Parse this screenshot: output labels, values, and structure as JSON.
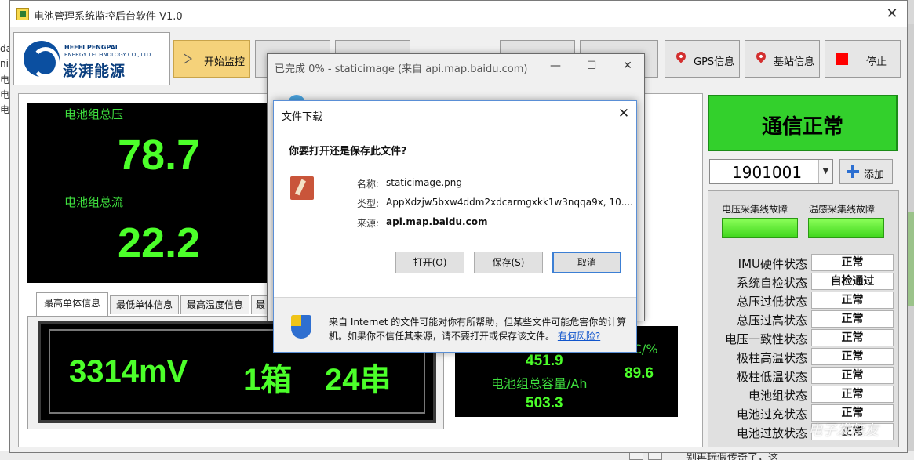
{
  "background": {
    "left_strip_texts": [
      "da",
      "niv",
      "电",
      "电",
      "电"
    ],
    "bottom_text": "别再玩假传奇了，这"
  },
  "app": {
    "title": "电池管理系统监控后台软件 V1.0",
    "close_glyph": "✕"
  },
  "logo": {
    "line1": "HEFEI PENGPAI",
    "line2": "ENERGY TECHNOLOGY CO., LTD.",
    "name_cn": "澎湃能源"
  },
  "toolbar": {
    "start_label": "开始监控",
    "gps_label": "GPS信息",
    "station_label": "基站信息",
    "stop_label": "停止"
  },
  "gauges": {
    "voltage_label": "电池组总压",
    "voltage_value": "78.7",
    "current_label": "电池组总流",
    "current_value": "22.2"
  },
  "tabs": [
    "最高单体信息",
    "最低单体信息",
    "最高温度信息",
    "最"
  ],
  "cell_display": {
    "voltage": "3314mV",
    "box": "1箱",
    "string": "24串"
  },
  "soc_panel": {
    "top_value": "451.9",
    "soc_label": "SOC/%",
    "soc_value": "89.6",
    "capacity_label": "电池组总容量/Ah",
    "capacity_value": "503.3"
  },
  "comm": {
    "status": "通信正常",
    "device_id": "1901001",
    "add_label": "添加"
  },
  "faults": {
    "voltage_line": "电压采集线故障",
    "temp_line": "温感采集线故障"
  },
  "status_rows": [
    {
      "name": "IMU硬件状态",
      "value": "正常"
    },
    {
      "name": "系统自检状态",
      "value": "自检通过"
    },
    {
      "name": "总压过低状态",
      "value": "正常"
    },
    {
      "name": "总压过高状态",
      "value": "正常"
    },
    {
      "name": "电压一致性状态",
      "value": "正常"
    },
    {
      "name": "极柱高温状态",
      "value": "正常"
    },
    {
      "name": "极柱低温状态",
      "value": "正常"
    },
    {
      "name": "电池组状态",
      "value": "正常"
    },
    {
      "name": "电池过充状态",
      "value": "正常"
    },
    {
      "name": "电池过放状态",
      "value": "正常"
    }
  ],
  "browser_dialog": {
    "title": "已完成 0% - staticimage (来自 api.map.baidu.com)",
    "minimize": "—",
    "maximize": "☐",
    "close": "✕"
  },
  "download_dialog": {
    "title": "文件下载",
    "question": "你要打开还是保存此文件?",
    "name_key": "名称:",
    "name_value": "staticimage.png",
    "type_key": "类型:",
    "type_value": "AppXdzjw5bxw4ddm2xdcarmgxkk1w3nqqa9x, 10....",
    "source_key": "来源:",
    "source_value": "api.map.baidu.com",
    "open_label": "打开(O)",
    "save_label": "保存(S)",
    "cancel_label": "取消",
    "warning_text": "来自 Internet 的文件可能对你有所帮助，但某些文件可能危害你的计算机。如果你不信任其来源，请不要打开或保存该文件。",
    "risk_link": "有何风险?",
    "close": "✕"
  },
  "watermark": "电子发烧友"
}
